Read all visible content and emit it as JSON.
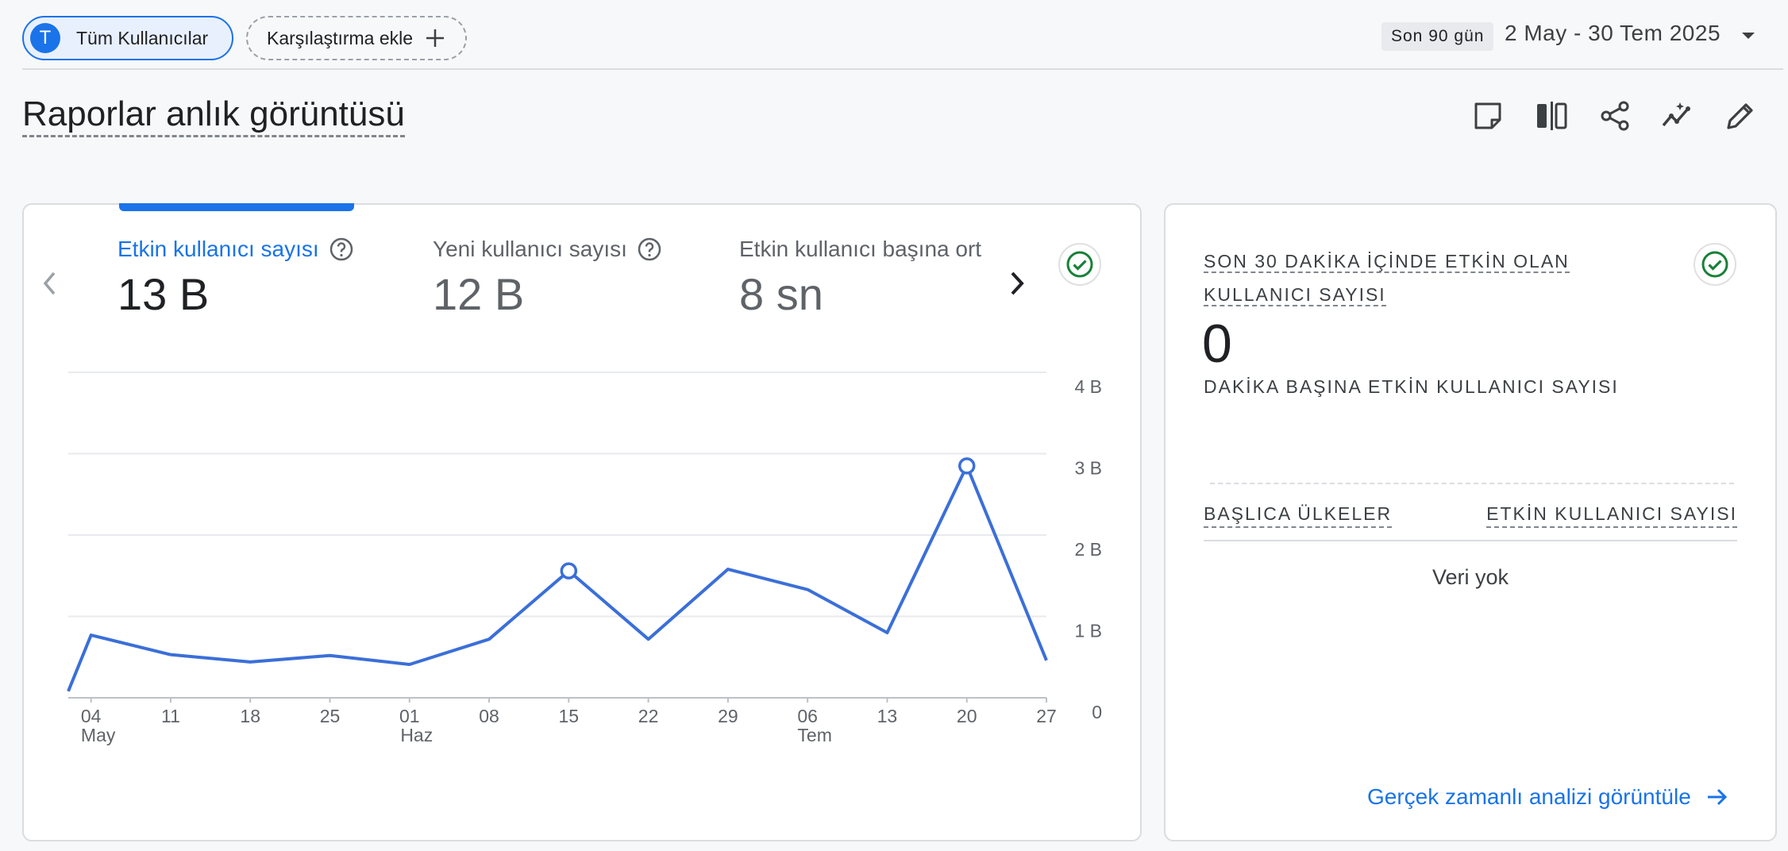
{
  "topbar": {
    "segment_avatar_letter": "T",
    "segment_label": "Tüm Kullanıcılar",
    "compare_label": "Karşılaştırma ekle",
    "date_preset": "Son 90 gün",
    "date_range": "2 May - 30 Tem 2025"
  },
  "page": {
    "title": "Raporlar anlık görüntüsü",
    "toolbar_icons": [
      "note-icon",
      "compare-columns-icon",
      "share-icon",
      "insights-icon",
      "edit-icon"
    ]
  },
  "metrics": [
    {
      "label": "Etkin kullanıcı sayısı",
      "value": "13 B",
      "selected": true
    },
    {
      "label": "Yeni kullanıcı sayısı",
      "value": "12 B",
      "selected": false
    },
    {
      "label": "Etkin kullanıcı başına ort",
      "value": "8 sn",
      "selected": false
    }
  ],
  "chart_data": {
    "type": "line",
    "title": "",
    "xlabel": "",
    "ylabel": "",
    "ylim": [
      0,
      4000
    ],
    "y_ticks": [
      {
        "value": 0,
        "label": "0"
      },
      {
        "value": 1000,
        "label": "1 B"
      },
      {
        "value": 2000,
        "label": "2 B"
      },
      {
        "value": 3000,
        "label": "3 B"
      },
      {
        "value": 4000,
        "label": "4 B"
      }
    ],
    "x_ticks": [
      {
        "day": 4,
        "label": "04",
        "month": "May"
      },
      {
        "day": 11,
        "label": "11"
      },
      {
        "day": 18,
        "label": "18"
      },
      {
        "day": 25,
        "label": "25"
      },
      {
        "day": 32,
        "label": "01",
        "month": "Haz"
      },
      {
        "day": 39,
        "label": "08"
      },
      {
        "day": 46,
        "label": "15"
      },
      {
        "day": 53,
        "label": "22"
      },
      {
        "day": 60,
        "label": "29"
      },
      {
        "day": 67,
        "label": "06",
        "month": "Tem"
      },
      {
        "day": 74,
        "label": "13"
      },
      {
        "day": 81,
        "label": "20"
      },
      {
        "day": 88,
        "label": "27"
      }
    ],
    "series": [
      {
        "color": "#3b6fd8",
        "points": [
          {
            "x": 2,
            "y": 80
          },
          {
            "x": 4,
            "y": 770
          },
          {
            "x": 11,
            "y": 530
          },
          {
            "x": 18,
            "y": 440
          },
          {
            "x": 25,
            "y": 520
          },
          {
            "x": 32,
            "y": 410
          },
          {
            "x": 39,
            "y": 720
          },
          {
            "x": 46,
            "y": 1560
          },
          {
            "x": 53,
            "y": 720
          },
          {
            "x": 60,
            "y": 1580
          },
          {
            "x": 67,
            "y": 1330
          },
          {
            "x": 74,
            "y": 800
          },
          {
            "x": 81,
            "y": 2850
          },
          {
            "x": 88,
            "y": 460
          }
        ],
        "highlighted": [
          46,
          81
        ]
      }
    ],
    "grid": true
  },
  "realtime": {
    "title": "SON 30 DAKİKA İÇİNDE ETKİN OLAN KULLANICI SAYISI",
    "value": "0",
    "subtitle": "DAKİKA BAŞINA ETKİN KULLANICI SAYISI",
    "col_countries": "BAŞLICA ÜLKELER",
    "col_users": "ETKİN KULLANICI SAYISI",
    "empty": "Veri yok",
    "link": "Gerçek zamanlı analizi görüntüle"
  },
  "colors": {
    "accent": "#1a73e8",
    "line": "#3b6fd8",
    "check": "#188038"
  }
}
